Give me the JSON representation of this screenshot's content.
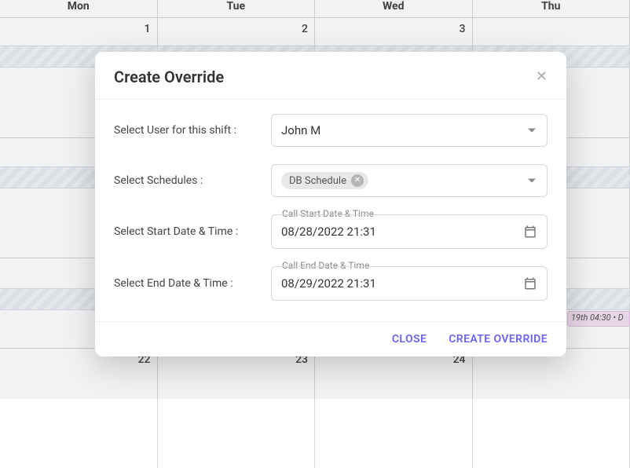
{
  "calendar": {
    "day_headers": [
      "Mon",
      "Tue",
      "Wed",
      "Thu"
    ],
    "rows": [
      [
        "1",
        "2",
        "3",
        ""
      ],
      [
        "",
        "",
        "",
        ""
      ],
      [
        "",
        "",
        "",
        ""
      ],
      [
        "22",
        "23",
        "24",
        ""
      ]
    ],
    "event_text": "19th 04:30  •  D"
  },
  "modal": {
    "title": "Create Override",
    "labels": {
      "user": "Select User for this shift :",
      "schedules": "Select Schedules :",
      "start": "Select Start Date & Time :",
      "end": "Select End Date & Time :"
    },
    "user_select": {
      "value": "John M"
    },
    "schedule_chip": "DB Schedule",
    "start_field": {
      "floating": "Call Start Date & Time",
      "value": "08/28/2022 21:31"
    },
    "end_field": {
      "floating": "Call End Date & Time",
      "value": "08/29/2022 21:31"
    },
    "buttons": {
      "close": "CLOSE",
      "create": "CREATE OVERRIDE"
    },
    "accent_color": "#6a62f1"
  }
}
